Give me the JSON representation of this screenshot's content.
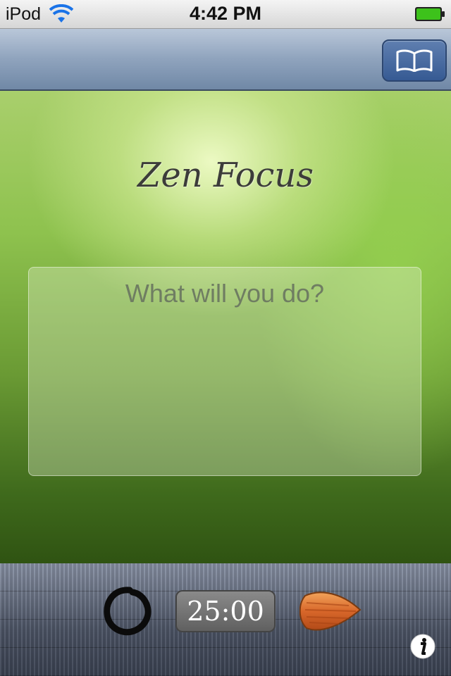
{
  "status_bar": {
    "carrier": "iPod",
    "time": "4:42 PM",
    "wifi_icon": "wifi-icon",
    "battery_icon": "battery-full-icon"
  },
  "nav_bar": {
    "book_button_icon": "open-book-icon"
  },
  "main": {
    "title": "Zen Focus",
    "task_placeholder": "What will you do?"
  },
  "bottom_bar": {
    "enso_icon": "enso-circle-icon",
    "timer": "25:00",
    "pick_icon": "guitar-pick-icon",
    "info_icon": "info-icon"
  },
  "colors": {
    "nav_button": "#3f649c",
    "battery": "#3dc21b",
    "title_text": "#3c3c3a",
    "placeholder_text": "#6f7d62"
  }
}
